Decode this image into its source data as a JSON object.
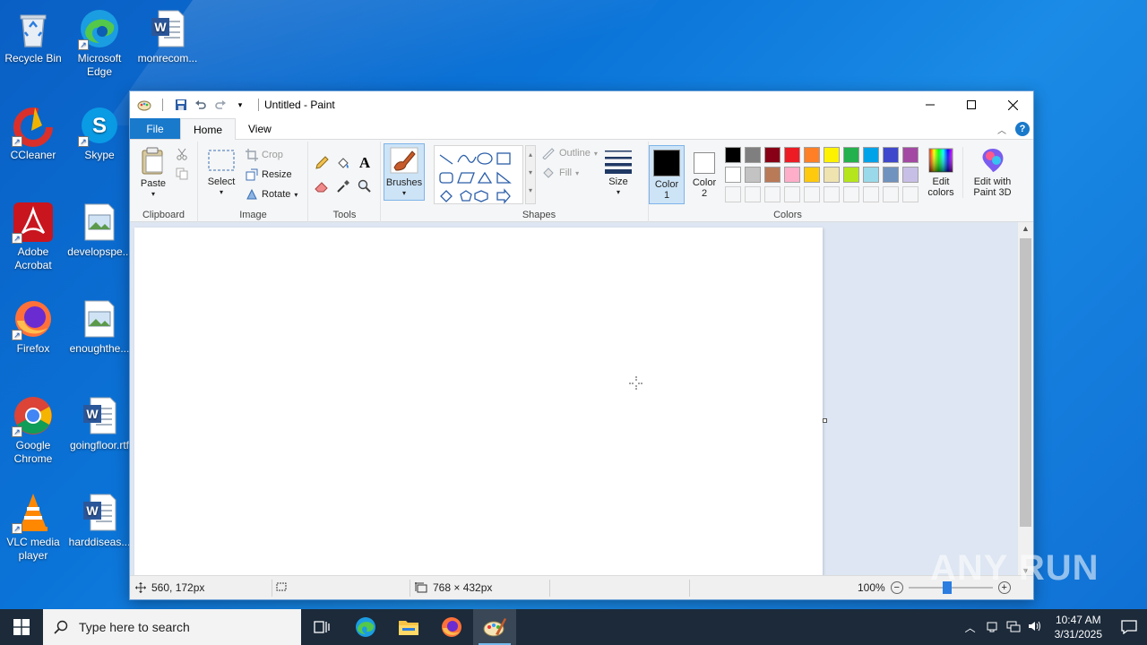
{
  "desktop": {
    "icons": [
      {
        "label": "Recycle Bin"
      },
      {
        "label": "Microsoft Edge"
      },
      {
        "label": "monrecom..."
      },
      {
        "label": "CCleaner"
      },
      {
        "label": "Skype"
      },
      {
        "label": "Adobe Acrobat"
      },
      {
        "label": "developspe..."
      },
      {
        "label": "Firefox"
      },
      {
        "label": "enoughthe..."
      },
      {
        "label": "Google Chrome"
      },
      {
        "label": "goingfloor.rtf"
      },
      {
        "label": "VLC media player"
      },
      {
        "label": "harddiseas..."
      }
    ]
  },
  "paint": {
    "title": "Untitled - Paint",
    "tabs": {
      "file": "File",
      "home": "Home",
      "view": "View"
    },
    "groups": {
      "clipboard": "Clipboard",
      "image": "Image",
      "tools": "Tools",
      "shapes": "Shapes",
      "colors": "Colors"
    },
    "buttons": {
      "paste": "Paste",
      "select": "Select",
      "crop": "Crop",
      "resize": "Resize",
      "rotate": "Rotate",
      "brushes": "Brushes",
      "outline": "Outline",
      "fill": "Fill",
      "size": "Size",
      "color1": "Color 1",
      "color2": "Color 2",
      "edit_colors": "Edit colors",
      "edit_paint3d": "Edit with Paint 3D"
    },
    "palette_row1": [
      "#000000",
      "#7f7f7f",
      "#880015",
      "#ed1c24",
      "#ff7f27",
      "#fff200",
      "#22b14c",
      "#00a2e8",
      "#3f48cc",
      "#a349a4"
    ],
    "palette_row2": [
      "#ffffff",
      "#c3c3c3",
      "#b97a57",
      "#ffaec9",
      "#ffc90e",
      "#efe4b0",
      "#b5e61d",
      "#99d9ea",
      "#7092be",
      "#c8bfe7"
    ],
    "color1_value": "#000000",
    "color2_value": "#ffffff",
    "status": {
      "cursor_pos": "560, 172px",
      "canvas_size": "768 × 432px",
      "zoom": "100%"
    }
  },
  "taskbar": {
    "search_placeholder": "Type here to search",
    "time": "10:47 AM",
    "date": "3/31/2025"
  },
  "watermark": "ANY RUN"
}
